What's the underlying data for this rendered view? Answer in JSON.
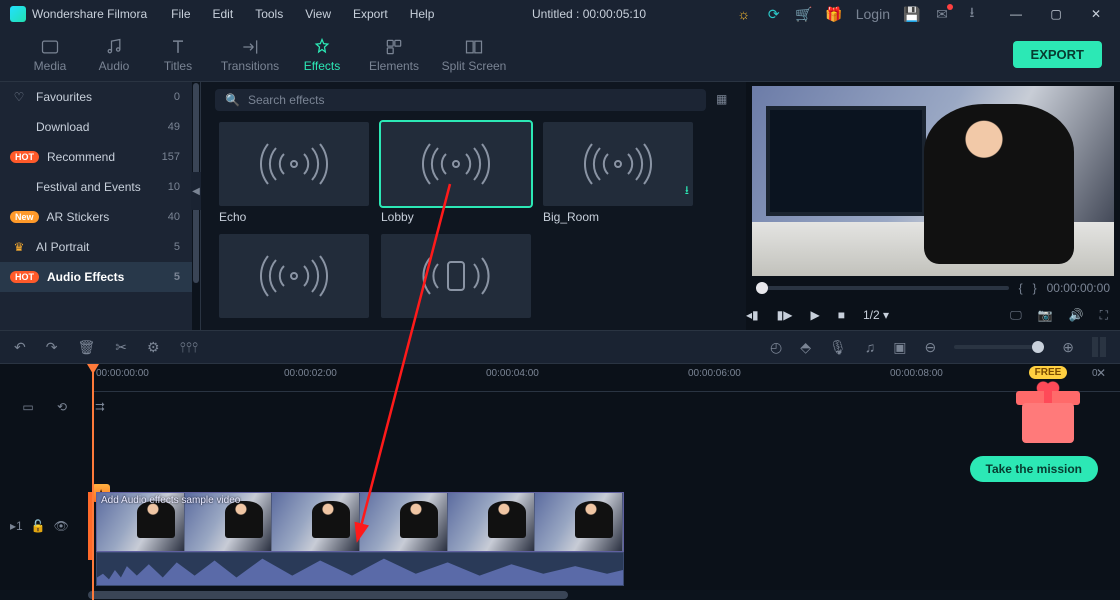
{
  "app": {
    "name": "Wondershare Filmora"
  },
  "menu": {
    "file": "File",
    "edit": "Edit",
    "tools": "Tools",
    "view": "View",
    "export": "Export",
    "help": "Help"
  },
  "title_center": "Untitled : 00:00:05:10",
  "login_label": "Login",
  "modes": {
    "media": "Media",
    "audio": "Audio",
    "titles": "Titles",
    "transitions": "Transitions",
    "effects": "Effects",
    "elements": "Elements",
    "split": "Split Screen"
  },
  "export_button": "EXPORT",
  "sidebar": {
    "items": [
      {
        "icon": "heart",
        "label": "Favourites",
        "count": "0"
      },
      {
        "label": "Download",
        "count": "49"
      },
      {
        "badge": "HOT",
        "label": "Recommend",
        "count": "157"
      },
      {
        "label": "Festival and Events",
        "count": "10"
      },
      {
        "badge": "New",
        "label": "AR Stickers",
        "count": "40"
      },
      {
        "icon": "crown",
        "label": "AI Portrait",
        "count": "5"
      },
      {
        "badge": "HOT",
        "label": "Audio Effects",
        "count": "5",
        "active": true
      }
    ]
  },
  "search": {
    "placeholder": "Search effects"
  },
  "fx": {
    "items": [
      {
        "label": "Echo"
      },
      {
        "label": "Lobby",
        "selected": true
      },
      {
        "label": "Big_Room",
        "download": true
      },
      {
        "label": ""
      },
      {
        "label": "",
        "phone": true
      }
    ]
  },
  "preview": {
    "time_markers": {
      "left": "{",
      "right": "}"
    },
    "timecode": "00:00:00:00",
    "speed": "1/2",
    "speed_suffix": "▾"
  },
  "ruler": [
    "00:00:00:00",
    "00:00:02:00",
    "00:00:04:00",
    "00:00:06:00",
    "00:00:08:00",
    "0"
  ],
  "track_head": {
    "id": "▸1",
    "lock": "🔓",
    "eye": "👁"
  },
  "clip_title": "Add Audio effects sample video",
  "free_label": "FREE",
  "cta_label": "Take the mission"
}
